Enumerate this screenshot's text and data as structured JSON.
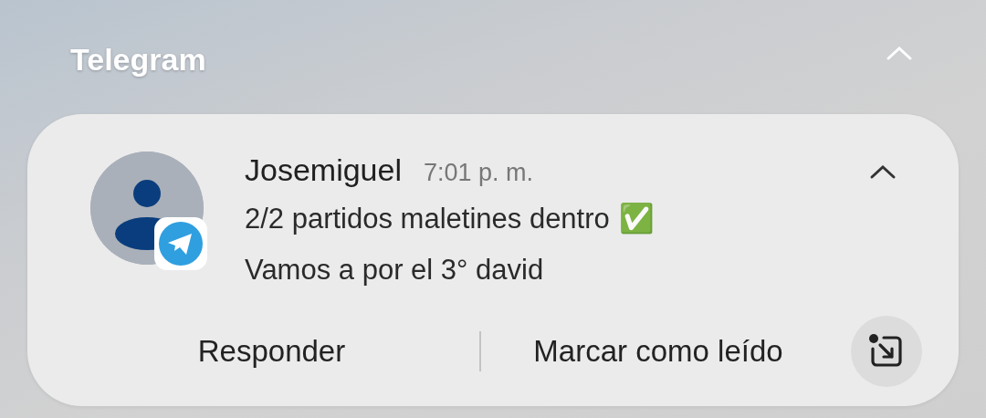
{
  "group": {
    "app_name": "Telegram",
    "expanded": true
  },
  "notification": {
    "sender": "Josemiguel",
    "time": "7:01 p. m.",
    "expanded": true,
    "lines": [
      {
        "text": "2/2 partidos maletines dentro",
        "emoji": "✅"
      },
      {
        "text": "Vamos a por el 3° david"
      }
    ],
    "actions": [
      "Responder",
      "Marcar como leído"
    ]
  }
}
